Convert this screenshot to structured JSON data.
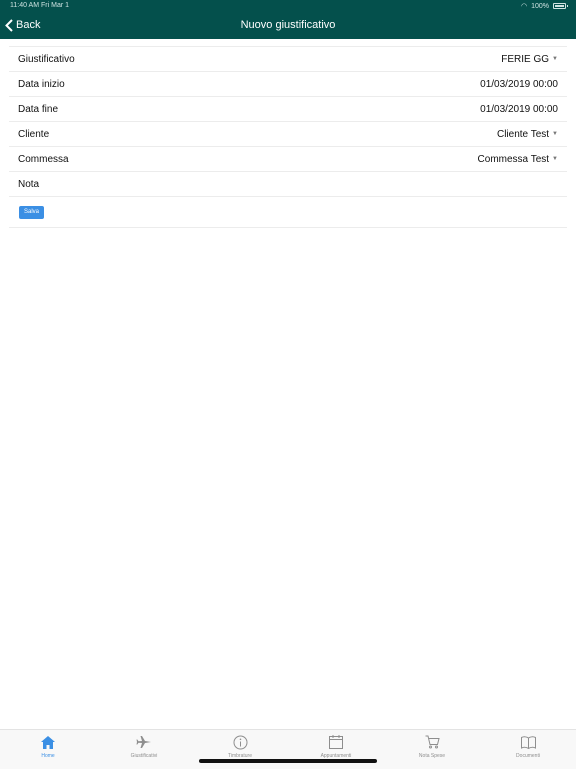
{
  "status": {
    "time": "11:40 AM",
    "date": "Fri Mar 1",
    "battery": "100%"
  },
  "nav": {
    "back_label": "Back",
    "title": "Nuovo giustificativo"
  },
  "form": {
    "rows": [
      {
        "label": "Giustificativo",
        "value": "FERIE GG",
        "dropdown": true
      },
      {
        "label": "Data inizio",
        "value": "01/03/2019 00:00",
        "dropdown": false
      },
      {
        "label": "Data fine",
        "value": "01/03/2019 00:00",
        "dropdown": false
      },
      {
        "label": "Cliente",
        "value": "Cliente Test",
        "dropdown": true
      },
      {
        "label": "Commessa",
        "value": "Commessa Test",
        "dropdown": true
      },
      {
        "label": "Nota",
        "value": "",
        "dropdown": false
      }
    ],
    "save_label": "Salva"
  },
  "tabs": [
    {
      "label": "Home",
      "icon": "home-icon",
      "active": true
    },
    {
      "label": "Giustificativi",
      "icon": "airplane-icon",
      "active": false
    },
    {
      "label": "Timbrature",
      "icon": "info-icon",
      "active": false
    },
    {
      "label": "Appuntamenti",
      "icon": "calendar-icon",
      "active": false
    },
    {
      "label": "Nota Spese",
      "icon": "cart-icon",
      "active": false
    },
    {
      "label": "Documenti",
      "icon": "book-icon",
      "active": false
    }
  ],
  "colors": {
    "header": "#04504c",
    "accent": "#3b8fe4"
  }
}
